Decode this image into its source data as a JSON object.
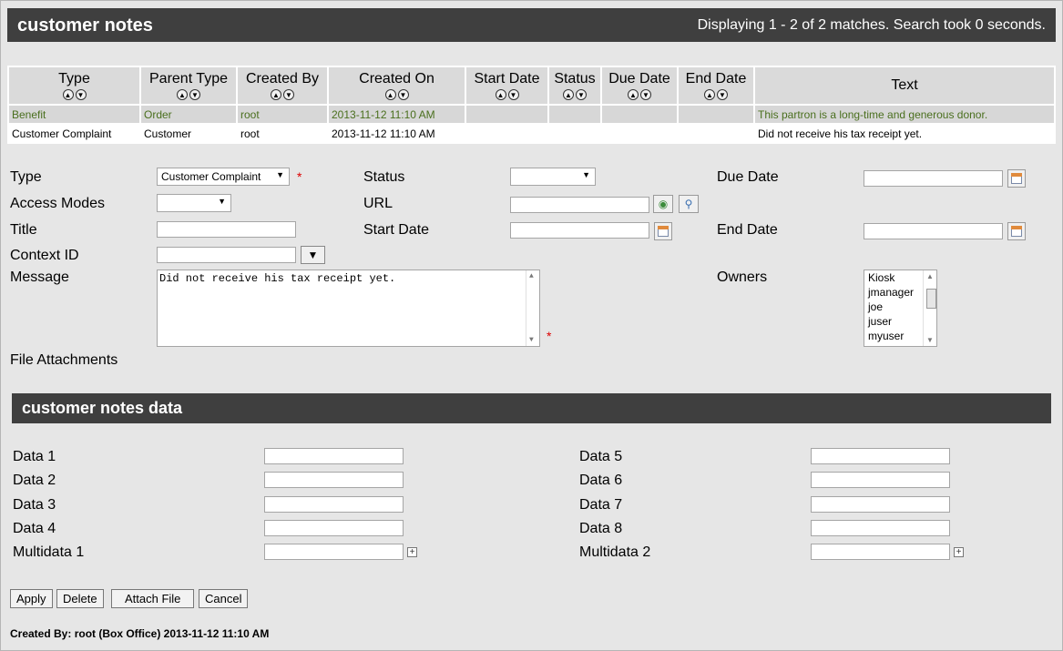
{
  "header": {
    "title": "customer notes",
    "status": "Displaying 1 - 2 of 2 matches. Search took 0 seconds."
  },
  "table": {
    "columns": [
      "Type",
      "Parent Type",
      "Created By",
      "Created On",
      "Start Date",
      "Status",
      "Due Date",
      "End Date",
      "Text"
    ],
    "rows": [
      [
        "Benefit",
        "Order",
        "root",
        "2013-11-12 11:10 AM",
        "",
        "",
        "",
        "",
        "This partron is a long-time and generous donor."
      ],
      [
        "Customer Complaint",
        "Customer",
        "root",
        "2013-11-12 11:10 AM",
        "",
        "",
        "",
        "",
        "Did not receive his tax receipt yet."
      ]
    ]
  },
  "form": {
    "type_label": "Type",
    "type_value": "Customer Complaint",
    "access_label": "Access Modes",
    "access_value": "",
    "title_label": "Title",
    "title_value": "",
    "context_label": "Context ID",
    "context_value": "",
    "message_label": "Message",
    "message_value": "Did not receive his tax receipt yet.",
    "attachments_label": "File Attachments",
    "status_label": "Status",
    "status_value": "",
    "url_label": "URL",
    "url_value": "",
    "start_label": "Start Date",
    "start_value": "",
    "due_label": "Due Date",
    "due_value": "",
    "end_label": "End Date",
    "end_value": "",
    "owners_label": "Owners",
    "owners": [
      "Kiosk",
      "jmanager",
      "joe",
      "juser",
      "myuser"
    ]
  },
  "data_section": {
    "title": "customer notes data",
    "data1": "Data 1",
    "data2": "Data 2",
    "data3": "Data 3",
    "data4": "Data 4",
    "multidata1": "Multidata 1",
    "data5": "Data 5",
    "data6": "Data 6",
    "data7": "Data 7",
    "data8": "Data 8",
    "multidata2": "Multidata 2"
  },
  "buttons": {
    "apply": "Apply",
    "delete": "Delete",
    "attach": "Attach File",
    "cancel": "Cancel"
  },
  "footer": "Created By: root (Box Office) 2013-11-12 11:10 AM"
}
